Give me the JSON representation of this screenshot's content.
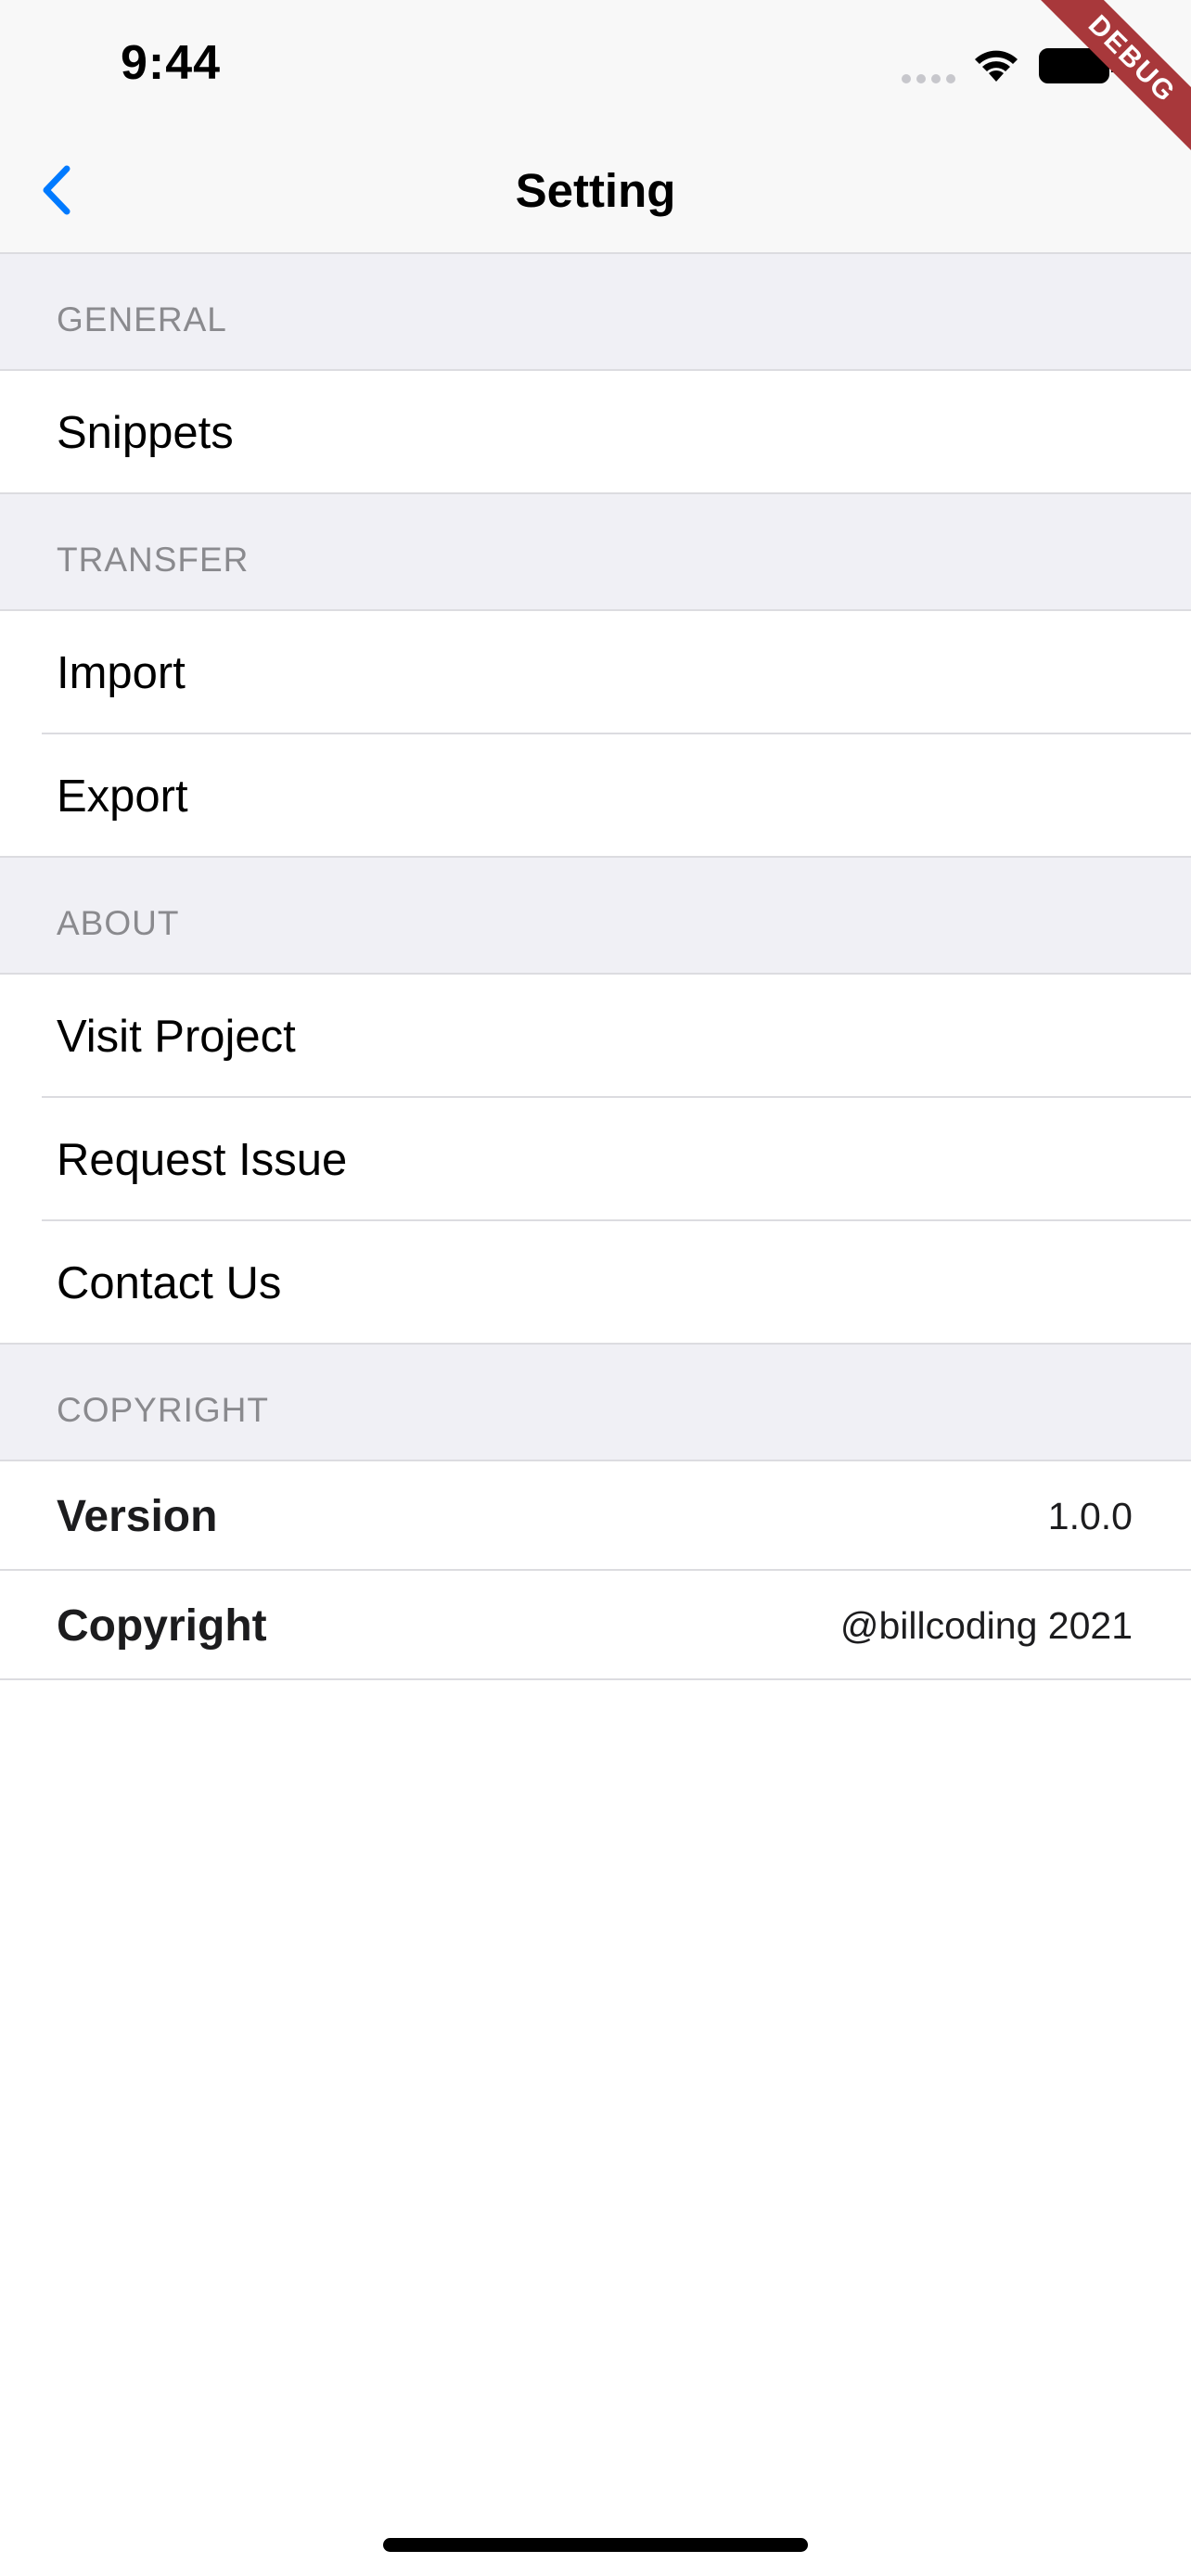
{
  "status_bar": {
    "time": "9:44"
  },
  "nav": {
    "title": "Setting"
  },
  "debug_banner": "DEBUG",
  "sections": {
    "general": {
      "header": "GENERAL",
      "items": [
        "Snippets"
      ]
    },
    "transfer": {
      "header": "TRANSFER",
      "items": [
        "Import",
        "Export"
      ]
    },
    "about": {
      "header": "ABOUT",
      "items": [
        "Visit Project",
        "Request Issue",
        "Contact Us"
      ]
    },
    "copyright": {
      "header": "COPYRIGHT",
      "rows": [
        {
          "label": "Version",
          "value": "1.0.0"
        },
        {
          "label": "Copyright",
          "value": "@billcoding 2021"
        }
      ]
    }
  },
  "colors": {
    "accent": "#007aff",
    "section_bg": "#f0f0f5",
    "debug_banner": "#a8383b"
  }
}
